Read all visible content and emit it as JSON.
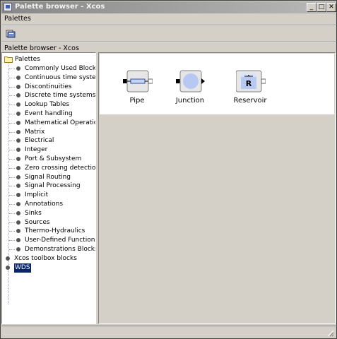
{
  "window": {
    "title": "Palette browser - Xcos"
  },
  "menubar": {
    "palettes": "Palettes"
  },
  "toolbar": {
    "open_icon": "folder-open-icon"
  },
  "path_label": "Palette browser - Xcos",
  "tree": {
    "root": "Palettes",
    "items": [
      "Commonly Used Blocks",
      "Continuous time systems",
      "Discontinuities",
      "Discrete time systems",
      "Lookup Tables",
      "Event handling",
      "Mathematical Operations",
      "Matrix",
      "Electrical",
      "Integer",
      "Port & Subsystem",
      "Zero crossing detection",
      "Signal Routing",
      "Signal Processing",
      "Implicit",
      "Annotations",
      "Sinks",
      "Sources",
      "Thermo-Hydraulics",
      "User-Defined Functions",
      "Demonstrations Blocks"
    ],
    "extra": [
      "Xcos toolbox blocks",
      "WDS"
    ],
    "selected": "WDS"
  },
  "blocks": [
    {
      "name": "Pipe",
      "icon": "pipe-block-icon"
    },
    {
      "name": "Junction",
      "icon": "junction-block-icon"
    },
    {
      "name": "Reservoir",
      "icon": "reservoir-block-icon",
      "symbol": "R"
    }
  ],
  "colors": {
    "selection": "#0a246a",
    "junction_fill": "#b7c8f2",
    "block_face": "#e6e6e6"
  }
}
